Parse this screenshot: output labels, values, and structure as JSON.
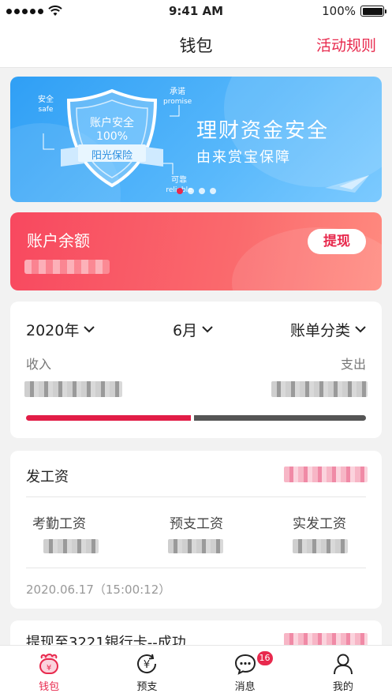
{
  "status_bar": {
    "time": "9:41 AM",
    "battery": "100%"
  },
  "nav": {
    "title": "钱包",
    "action": "活动规则"
  },
  "banner": {
    "shield_text": "账户安全",
    "shield_percent": "100%",
    "ribbon": "阳光保险",
    "tag_safe_cn": "安全",
    "tag_safe_en": "safe",
    "tag_promise_cn": "承诺",
    "tag_promise_en": "promise",
    "tag_reliable_cn": "可靠",
    "tag_reliable_en": "reliable",
    "headline": "理财资金安全",
    "subline": "由来赏宝保障",
    "slides": 4,
    "active_slide": 1
  },
  "balance": {
    "title": "账户余额",
    "withdraw_label": "提现"
  },
  "filters": {
    "year": "2020年",
    "month": "6月",
    "category": "账单分类",
    "income_label": "收入",
    "expense_label": "支出",
    "income_share": 0.49
  },
  "salary": {
    "title": "发工资",
    "col1": "考勤工资",
    "col2": "预支工资",
    "col3": "实发工资",
    "time": "2020.06.17（15:00:12）"
  },
  "partial": {
    "title": "提现至3221银行卡--成功"
  },
  "tabs": [
    {
      "label": "钱包",
      "icon": "wallet-icon",
      "active": true
    },
    {
      "label": "预支",
      "icon": "yuan-refresh-icon",
      "active": false
    },
    {
      "label": "消息",
      "icon": "message-icon",
      "active": false,
      "badge": "16"
    },
    {
      "label": "我的",
      "icon": "user-icon",
      "active": false
    }
  ],
  "colors": {
    "accent": "#e8294d",
    "banner_blue": "#3aa6f7"
  }
}
